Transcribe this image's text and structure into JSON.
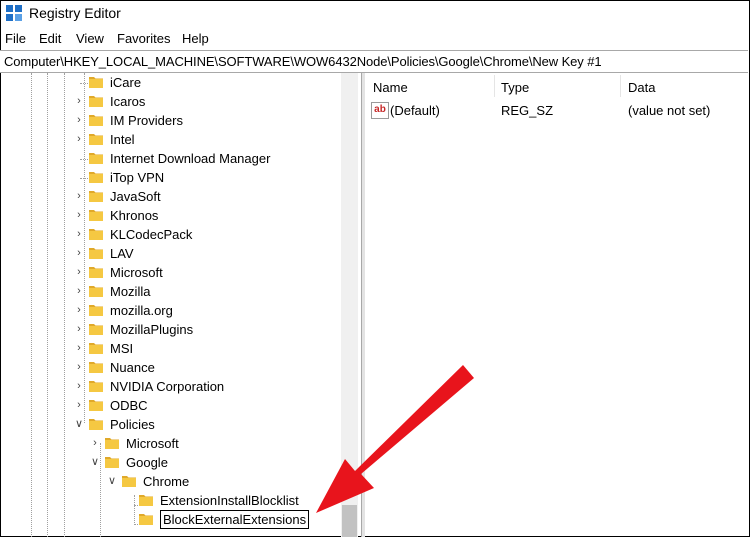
{
  "window": {
    "title": "Registry Editor"
  },
  "menu": [
    "File",
    "Edit",
    "View",
    "Favorites",
    "Help"
  ],
  "address": "Computer\\HKEY_LOCAL_MACHINE\\SOFTWARE\\WOW6432Node\\Policies\\Google\\Chrome\\New Key #1",
  "tree": [
    {
      "label": "iCare",
      "expander": "none"
    },
    {
      "label": "Icaros",
      "expander": "collapsed"
    },
    {
      "label": "IM Providers",
      "expander": "collapsed"
    },
    {
      "label": "Intel",
      "expander": "collapsed"
    },
    {
      "label": "Internet Download Manager",
      "expander": "none"
    },
    {
      "label": "iTop VPN",
      "expander": "none"
    },
    {
      "label": "JavaSoft",
      "expander": "collapsed"
    },
    {
      "label": "Khronos",
      "expander": "collapsed"
    },
    {
      "label": "KLCodecPack",
      "expander": "collapsed"
    },
    {
      "label": "LAV",
      "expander": "collapsed"
    },
    {
      "label": "Microsoft",
      "expander": "collapsed"
    },
    {
      "label": "Mozilla",
      "expander": "collapsed"
    },
    {
      "label": "mozilla.org",
      "expander": "collapsed"
    },
    {
      "label": "MozillaPlugins",
      "expander": "collapsed"
    },
    {
      "label": "MSI",
      "expander": "collapsed"
    },
    {
      "label": "Nuance",
      "expander": "collapsed"
    },
    {
      "label": "NVIDIA Corporation",
      "expander": "collapsed"
    },
    {
      "label": "ODBC",
      "expander": "collapsed"
    },
    {
      "label": "Policies",
      "expander": "expanded"
    },
    {
      "label": "Microsoft",
      "expander": "collapsed"
    },
    {
      "label": "Google",
      "expander": "expanded"
    },
    {
      "label": "Chrome",
      "expander": "expanded"
    },
    {
      "label": "ExtensionInstallBlocklist",
      "expander": "none"
    },
    {
      "label": "BlockExternalExtensions",
      "expander": "none",
      "editing": true
    }
  ],
  "columns": {
    "name": "Name",
    "type": "Type",
    "data": "Data"
  },
  "values": [
    {
      "icon": "string-value-icon",
      "icon_text": "ab",
      "name": "(Default)",
      "type": "REG_SZ",
      "data": "(value not set)"
    }
  ],
  "colors": {
    "folder": "#f5c842",
    "folder_dark": "#e0a92a",
    "annotation_arrow": "#e8141c"
  }
}
